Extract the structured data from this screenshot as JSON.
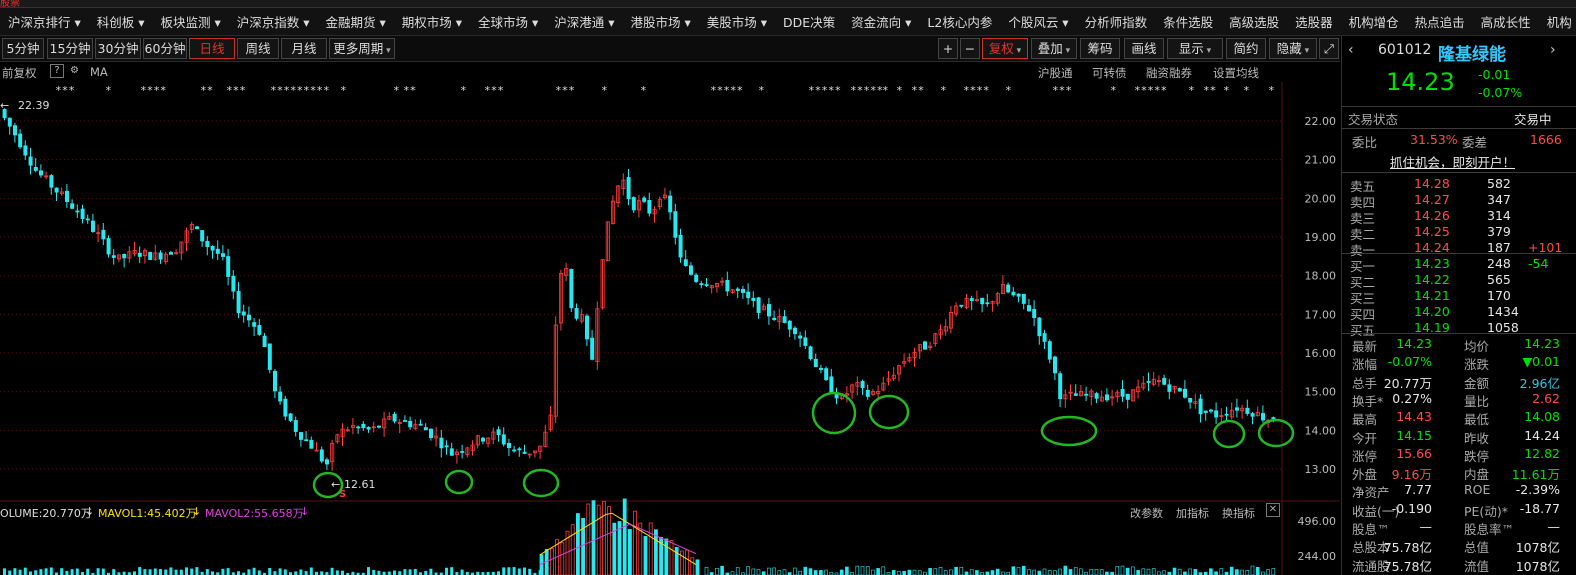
{
  "topbar": {
    "brand": "股票"
  },
  "nav": [
    "沪深京排行 ▾",
    "科创板 ▾",
    "板块监测 ▾",
    "沪深京指数 ▾",
    "金融期货 ▾",
    "期权市场 ▾",
    "全球市场 ▾",
    "沪深港通 ▾",
    "港股市场 ▾",
    "美股市场 ▾",
    "DDE决策",
    "资金流向 ▾",
    "L2核心内参",
    "个股风云 ▾",
    "分析师指数",
    "条件选股",
    "高级选股",
    "选股器",
    "机构增仓",
    "热点追击",
    "高成长性",
    "机构"
  ],
  "toolbar": {
    "periods": [
      "5分钟",
      "15分钟",
      "30分钟",
      "60分钟",
      "日线",
      "周线",
      "月线",
      "更多周期"
    ],
    "right": [
      "+",
      "−",
      "复权",
      "叠加",
      "筹码",
      "画线",
      "显示",
      "简约",
      "隐藏"
    ]
  },
  "subbar": {
    "adjust": "前复权",
    "help": "?",
    "ma": "MA",
    "links": [
      "沪股通",
      "可转债",
      "融资融券",
      "设置均线"
    ]
  },
  "chart": {
    "high_label": "22.39",
    "low_label": "12.61",
    "s_marker": "S",
    "y_ticks": [
      "22.00",
      "21.00",
      "20.00",
      "19.00",
      "18.00",
      "17.00",
      "16.00",
      "15.00",
      "14.00",
      "13.00"
    ],
    "vol_ticks": [
      "496.00",
      "244.00"
    ]
  },
  "volume": {
    "vol": "OLUME:20.770万",
    "vol_arrow": "↓",
    "ma1": "MAVOL1:45.402万",
    "ma1_arrow": "↓",
    "ma2": "MAVOL2:55.658万",
    "ma2_arrow": "↓",
    "buttons": [
      "改参数",
      "加指标",
      "换指标"
    ],
    "close": "✕"
  },
  "colors": {
    "up": "#ff3c3c",
    "down": "#26e8f0",
    "circle": "#22b822",
    "ma1": "#ffe000",
    "ma2": "#e040e0",
    "grid": "#5a1010"
  },
  "quote": {
    "code": "601012",
    "name": "隆基绿能",
    "price": "14.23",
    "change": "-0.01",
    "pct": "-0.07%",
    "status_label": "交易状态",
    "status": "交易中",
    "ratio_label": "委比",
    "ratio": "31.53%",
    "diff_label": "委差",
    "diff": "1666",
    "promo": "抓住机会，即刻开户！",
    "asks": [
      {
        "l": "卖五",
        "p": "14.28",
        "v": "582",
        "c": ""
      },
      {
        "l": "卖四",
        "p": "14.27",
        "v": "347",
        "c": ""
      },
      {
        "l": "卖三",
        "p": "14.26",
        "v": "314",
        "c": ""
      },
      {
        "l": "卖二",
        "p": "14.25",
        "v": "379",
        "c": ""
      },
      {
        "l": "卖一",
        "p": "14.24",
        "v": "187",
        "c": "+101"
      }
    ],
    "bids": [
      {
        "l": "买一",
        "p": "14.23",
        "v": "248",
        "c": "-54"
      },
      {
        "l": "买二",
        "p": "14.22",
        "v": "565",
        "c": ""
      },
      {
        "l": "买三",
        "p": "14.21",
        "v": "170",
        "c": ""
      },
      {
        "l": "买四",
        "p": "14.20",
        "v": "1434",
        "c": ""
      },
      {
        "l": "买五",
        "p": "14.19",
        "v": "1058",
        "c": ""
      }
    ],
    "stats": [
      {
        "a": "最新",
        "av": "14.23",
        "ac": "green",
        "b": "均价",
        "bv": "14.23",
        "bc": "green"
      },
      {
        "a": "涨幅",
        "av": "-0.07%",
        "ac": "green",
        "b": "涨跌",
        "bv": "▼0.01",
        "bc": "green"
      },
      {
        "a": "总手",
        "av": "20.77万",
        "ac": "white",
        "b": "金额",
        "bv": "2.96亿",
        "bc": "cyan"
      },
      {
        "a": "换手*",
        "av": "0.27%",
        "ac": "white",
        "b": "量比",
        "bv": "2.62",
        "bc": "red"
      },
      {
        "a": "最高",
        "av": "14.43",
        "ac": "red",
        "b": "最低",
        "bv": "14.08",
        "bc": "green"
      },
      {
        "a": "今开",
        "av": "14.15",
        "ac": "green",
        "b": "昨收",
        "bv": "14.24",
        "bc": "white"
      },
      {
        "a": "涨停",
        "av": "15.66",
        "ac": "red",
        "b": "跌停",
        "bv": "12.82",
        "bc": "green"
      },
      {
        "a": "外盘",
        "av": "9.16万",
        "ac": "red",
        "b": "内盘",
        "bv": "11.61万",
        "bc": "green"
      },
      {
        "a": "净资产",
        "av": "7.77",
        "ac": "white",
        "b": "ROE",
        "bv": "-2.39%",
        "bc": "white"
      },
      {
        "a": "收益(一)",
        "av": "-0.190",
        "ac": "white",
        "b": "PE(动)*",
        "bv": "-18.77",
        "bc": "white"
      },
      {
        "a": "股息™",
        "av": "—",
        "ac": "white",
        "b": "股息率™",
        "bv": "—",
        "bc": "white"
      },
      {
        "a": "总股本",
        "av": "75.78亿",
        "ac": "white",
        "b": "总值",
        "bv": "1078亿",
        "bc": "white"
      },
      {
        "a": "流通股",
        "av": "75.78亿",
        "ac": "white",
        "b": "流值",
        "bv": "1078亿",
        "bc": "white"
      }
    ]
  }
}
